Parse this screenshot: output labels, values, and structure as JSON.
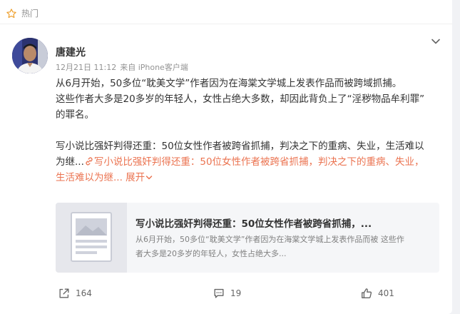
{
  "header": {
    "label": "热门",
    "icon": "star-outline-icon"
  },
  "post": {
    "author": "唐建光",
    "date": "12月21日 11:12",
    "source": "来自 iPhone客户端",
    "lines": [
      "从6月开始，50多位“耽美文学”作者因为在海棠文学城上发表作品而被跨域抓捕。",
      "这些作者大多是20多岁的年轻人，女性占绝大多数，却因此背负上了“淫秽物品牟利罪”",
      "的罪名。",
      "写小说比强奸判得还重：50位女性作者被跨省抓捕，判决之下的重病、失业，生活难以",
      "为继..."
    ],
    "link_part1": "写小说比强奸判得还重：50位女性作者被跨省抓捕，判决之下的重病、失业，",
    "link_part2": "生活难以为继...",
    "expand": "展开"
  },
  "article": {
    "title": "写小说比强奸判得还重：50位女性作者被跨省抓捕，...",
    "desc_line1": "从6月开始，50多位“耽美文学”作者因为在海棠文学城上发表作品而被 这些作",
    "desc_line2": "者大多是20多岁的年轻人，女性占绝大多..."
  },
  "actions": {
    "share": "164",
    "comment": "19",
    "like": "401"
  },
  "colors": {
    "accent": "#eb7350",
    "text": "#333333",
    "muted": "#939393"
  }
}
